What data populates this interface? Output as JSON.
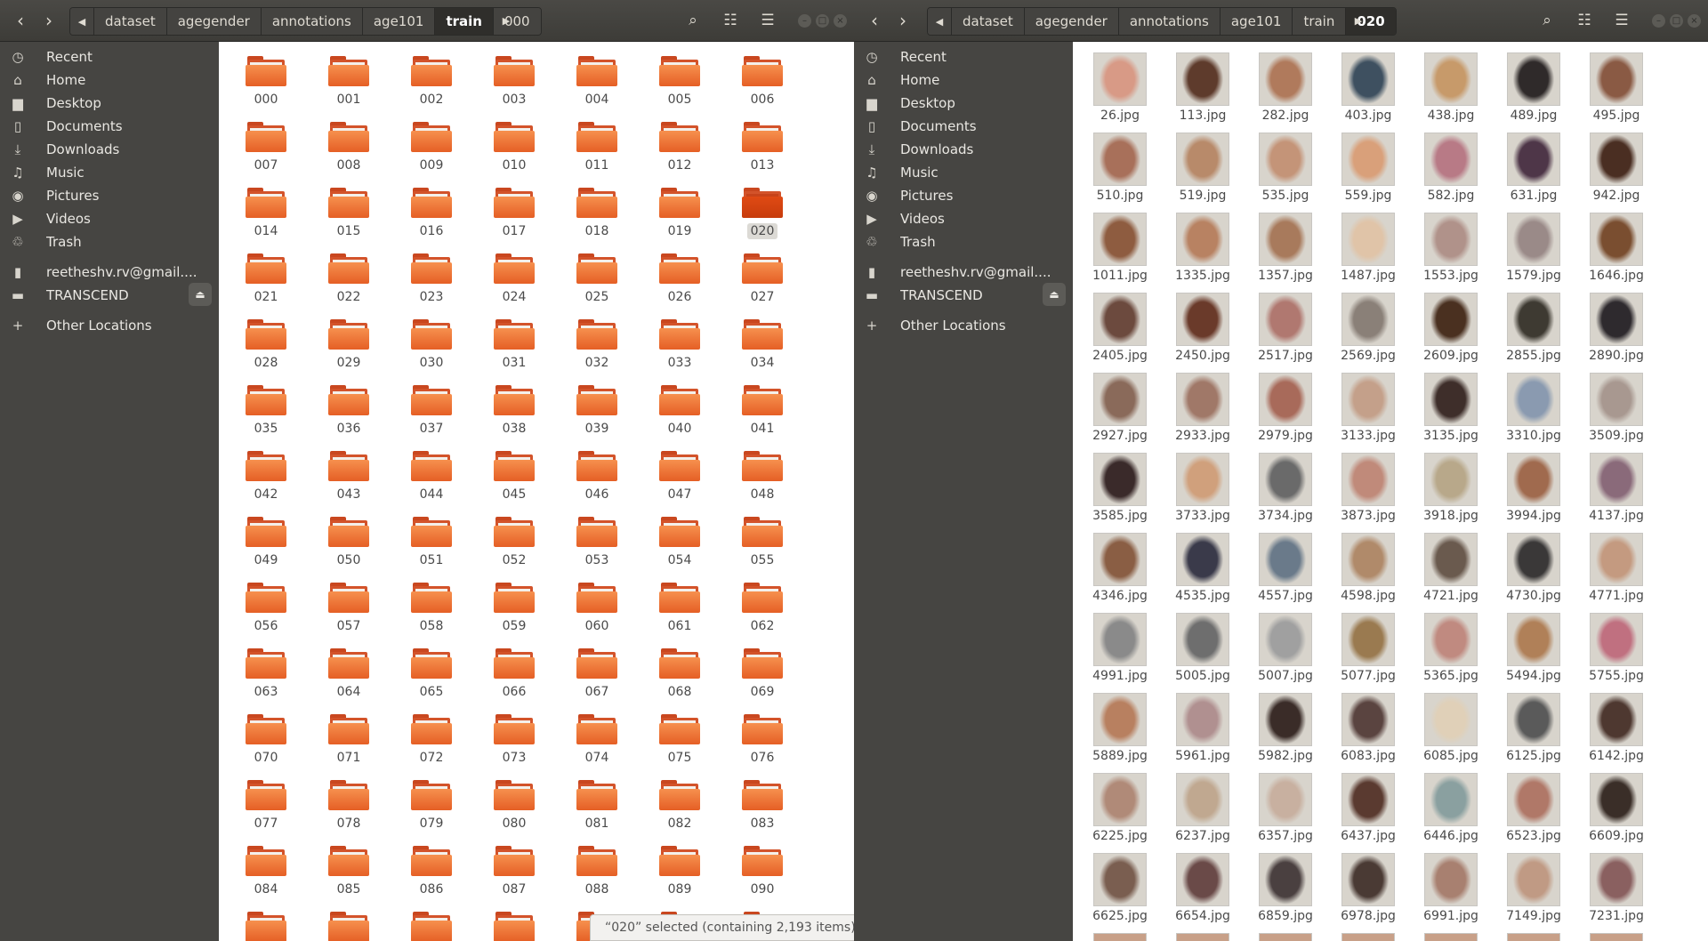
{
  "left": {
    "path": [
      "dataset",
      "agegender",
      "annotations",
      "age101",
      "train",
      "000"
    ],
    "active_crumb": 4,
    "sidebar": [
      {
        "label": "Recent",
        "icon": "clock-icon"
      },
      {
        "label": "Home",
        "icon": "home-icon"
      },
      {
        "label": "Desktop",
        "icon": "desktop-folder-icon"
      },
      {
        "label": "Documents",
        "icon": "document-icon"
      },
      {
        "label": "Downloads",
        "icon": "download-icon"
      },
      {
        "label": "Music",
        "icon": "music-icon"
      },
      {
        "label": "Pictures",
        "icon": "camera-icon"
      },
      {
        "label": "Videos",
        "icon": "video-icon"
      },
      {
        "label": "Trash",
        "icon": "trash-icon"
      },
      {
        "label": "reetheshv.rv@gmail....",
        "icon": "phone-icon"
      },
      {
        "label": "TRANSCEND",
        "icon": "drive-icon"
      },
      {
        "label": "Other Locations",
        "icon": "plus-icon"
      }
    ],
    "folders": [
      "000",
      "001",
      "002",
      "003",
      "004",
      "005",
      "006",
      "007",
      "008",
      "009",
      "010",
      "011",
      "012",
      "013",
      "014",
      "015",
      "016",
      "017",
      "018",
      "019",
      "020",
      "021",
      "022",
      "023",
      "024",
      "025",
      "026",
      "027",
      "028",
      "029",
      "030",
      "031",
      "032",
      "033",
      "034",
      "035",
      "036",
      "037",
      "038",
      "039",
      "040",
      "041",
      "042",
      "043",
      "044",
      "045",
      "046",
      "047",
      "048",
      "049",
      "050",
      "051",
      "052",
      "053",
      "054",
      "055",
      "056",
      "057",
      "058",
      "059",
      "060",
      "061",
      "062",
      "063",
      "064",
      "065",
      "066",
      "067",
      "068",
      "069",
      "070",
      "071",
      "072",
      "073",
      "074",
      "075",
      "076",
      "077",
      "078",
      "079",
      "080",
      "081",
      "082",
      "083",
      "084",
      "085",
      "086",
      "087",
      "088",
      "089",
      "090"
    ],
    "selected_folder": "020",
    "status": "“020” selected  (containing 2,193 items)"
  },
  "right": {
    "path": [
      "dataset",
      "agegender",
      "annotations",
      "age101",
      "train",
      "020"
    ],
    "active_crumb": 5,
    "sidebar": [
      {
        "label": "Recent",
        "icon": "clock-icon"
      },
      {
        "label": "Home",
        "icon": "home-icon"
      },
      {
        "label": "Desktop",
        "icon": "desktop-folder-icon"
      },
      {
        "label": "Documents",
        "icon": "document-icon"
      },
      {
        "label": "Downloads",
        "icon": "download-icon"
      },
      {
        "label": "Music",
        "icon": "music-icon"
      },
      {
        "label": "Pictures",
        "icon": "camera-icon"
      },
      {
        "label": "Videos",
        "icon": "video-icon"
      },
      {
        "label": "Trash",
        "icon": "trash-icon"
      },
      {
        "label": "reetheshv.rv@gmail....",
        "icon": "phone-icon"
      },
      {
        "label": "TRANSCEND",
        "icon": "drive-icon"
      },
      {
        "label": "Other Locations",
        "icon": "plus-icon"
      }
    ],
    "files": [
      "26.jpg",
      "113.jpg",
      "282.jpg",
      "403.jpg",
      "438.jpg",
      "489.jpg",
      "495.jpg",
      "510.jpg",
      "519.jpg",
      "535.jpg",
      "559.jpg",
      "582.jpg",
      "631.jpg",
      "942.jpg",
      "1011.jpg",
      "1335.jpg",
      "1357.jpg",
      "1487.jpg",
      "1553.jpg",
      "1579.jpg",
      "1646.jpg",
      "2405.jpg",
      "2450.jpg",
      "2517.jpg",
      "2569.jpg",
      "2609.jpg",
      "2855.jpg",
      "2890.jpg",
      "2927.jpg",
      "2933.jpg",
      "2979.jpg",
      "3133.jpg",
      "3135.jpg",
      "3310.jpg",
      "3509.jpg",
      "3585.jpg",
      "3733.jpg",
      "3734.jpg",
      "3873.jpg",
      "3918.jpg",
      "3994.jpg",
      "4137.jpg",
      "4346.jpg",
      "4535.jpg",
      "4557.jpg",
      "4598.jpg",
      "4721.jpg",
      "4730.jpg",
      "4771.jpg",
      "4991.jpg",
      "5005.jpg",
      "5007.jpg",
      "5077.jpg",
      "5365.jpg",
      "5494.jpg",
      "5755.jpg",
      "5889.jpg",
      "5961.jpg",
      "5982.jpg",
      "6083.jpg",
      "6085.jpg",
      "6125.jpg",
      "6142.jpg",
      "6225.jpg",
      "6237.jpg",
      "6357.jpg",
      "6437.jpg",
      "6446.jpg",
      "6523.jpg",
      "6609.jpg",
      "6625.jpg",
      "6654.jpg",
      "6859.jpg",
      "6978.jpg",
      "6991.jpg",
      "7149.jpg",
      "7231.jpg"
    ],
    "thumb_colors": [
      "#d89a86",
      "#5e3b2c",
      "#b07a5c",
      "#3e5060",
      "#c79a6a",
      "#2f2a2a",
      "#8a5a44",
      "#a8705a",
      "#b88a6a",
      "#c49478",
      "#d9a07a",
      "#b87a86",
      "#4e3648",
      "#4a2e22",
      "#8e5c40",
      "#b88262",
      "#a87a5c",
      "#e0c4a8",
      "#b0928a",
      "#9a8a88",
      "#7a4e30",
      "#6c4a3e",
      "#6a3a2a",
      "#b07870",
      "#8a8078",
      "#4a3020",
      "#3e3a32",
      "#2e2a2e",
      "#8a6a5a",
      "#a07868",
      "#a86a5a",
      "#c4a08a",
      "#3e2e2a",
      "#8a9ab0",
      "#a89890",
      "#3a2a2a",
      "#d0a07c",
      "#6a6a6a",
      "#c08a7a",
      "#b8a88a",
      "#a06a4e",
      "#8a6a7a",
      "#8a5e44",
      "#3a3a4a",
      "#6a7a8a",
      "#b08a6a",
      "#6a5a4e",
      "#3a3838",
      "#c49a80",
      "#8a8a8a",
      "#6e6e6e",
      "#a0a0a0",
      "#9a7a50",
      "#c08a80",
      "#b08058",
      "#c07080",
      "#b88060",
      "#b09090",
      "#3a2c28",
      "#5a4440",
      "#e0d0b8",
      "#5a5a5a",
      "#4e3830",
      "#b08a78",
      "#c0a890",
      "#c8b0a0",
      "#5a3a30",
      "#8aa0a0",
      "#b07868",
      "#3a2e28",
      "#7a5e50",
      "#6a4a48",
      "#4a4040",
      "#4a3a34",
      "#a88070",
      "#c09a84",
      "#8a6060"
    ]
  }
}
